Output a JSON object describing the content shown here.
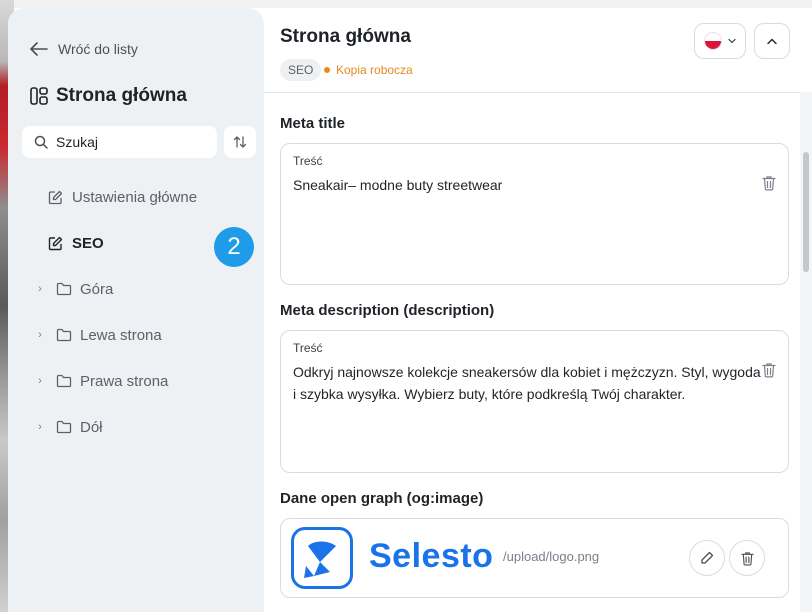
{
  "sidebar": {
    "back_label": "Wróć do listy",
    "title": "Strona główna",
    "search": {
      "value": "Szukaj",
      "placeholder": "Szukaj"
    },
    "items": [
      {
        "label": "Ustawienia główne",
        "icon": "edit-icon"
      },
      {
        "label": "SEO",
        "icon": "edit-icon",
        "active": true
      },
      {
        "label": "Góra",
        "icon": "folder-icon"
      },
      {
        "label": "Lewa strona",
        "icon": "folder-icon"
      },
      {
        "label": "Prawa strona",
        "icon": "folder-icon"
      },
      {
        "label": "Dół",
        "icon": "folder-icon"
      }
    ],
    "step_badge": "2"
  },
  "main": {
    "title": "Strona główna",
    "tag": "SEO",
    "status": "Kopia robocza",
    "language": "pl",
    "sections": [
      {
        "label": "Meta title",
        "field_label": "Treść",
        "value": "Sneakair– modne buty streetwear"
      },
      {
        "label": "Meta description (description)",
        "field_label": "Treść",
        "value": "Odkryj najnowsze kolekcje sneakersów dla kobiet i mężczyzn. Styl, wygoda i szybka wysyłka. Wybierz buty, które podkreślą Twój charakter."
      },
      {
        "label": "Dane open graph (og:image)",
        "image_path": "/upload/logo.png",
        "logo_text": "Selesto"
      }
    ]
  },
  "colors": {
    "accent": "#1e9be9",
    "brand": "#1a73e8",
    "draft": "#e68a1a",
    "sidebar_bg": "#eef1f4"
  }
}
